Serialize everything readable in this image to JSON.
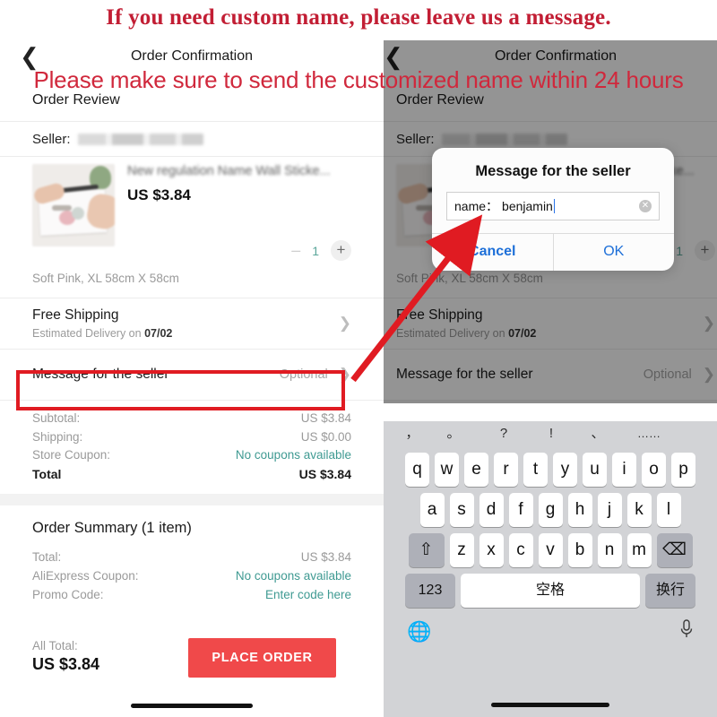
{
  "promo": {
    "line1": "If you need custom name, please leave us a message.",
    "line2": "Please make sure to send the customized name within 24 hours"
  },
  "navbar": {
    "title": "Order Confirmation",
    "back_icon": "chevron-left-icon"
  },
  "order_review": {
    "section_title": "Order Review",
    "seller_label": "Seller:",
    "product": {
      "title": "New regulation Name Wall Sticke...",
      "price": "US $3.84",
      "quantity": "1",
      "minus": "–",
      "plus": "+",
      "variant": "Soft Pink, XL 58cm X 58cm"
    },
    "shipping": {
      "title": "Free Shipping",
      "delivery_prefix": "Estimated Delivery on ",
      "delivery_date": "07/02"
    },
    "message_row": {
      "label": "Message for the seller",
      "value": "Optional"
    },
    "costs": [
      {
        "key": "Subtotal:",
        "value": "US $3.84",
        "teal": false
      },
      {
        "key": "Shipping:",
        "value": "US $0.00",
        "teal": false
      },
      {
        "key": "Store Coupon:",
        "value": "No coupons available",
        "teal": true
      }
    ],
    "total": {
      "key": "Total",
      "value": "US $3.84"
    }
  },
  "order_summary": {
    "heading": "Order Summary (1 item)",
    "rows": [
      {
        "key": "Total:",
        "value": "US $3.84",
        "teal": false
      },
      {
        "key": "AliExpress Coupon:",
        "value": "No coupons available",
        "teal": true
      },
      {
        "key": "Promo Code:",
        "value": "Enter code here",
        "teal": true
      }
    ],
    "all_total_label": "All Total:",
    "all_total_value": "US $3.84",
    "place_order_label": "PLACE ORDER"
  },
  "modal": {
    "title": "Message for the seller",
    "input_label": "name：",
    "input_value": "benjamin",
    "clear_icon": "✕",
    "cancel_label": "Cancel",
    "ok_label": "OK"
  },
  "keyboard": {
    "suggestions": [
      "，",
      "。",
      "?",
      "!",
      "、",
      "……"
    ],
    "row1": [
      "q",
      "w",
      "e",
      "r",
      "t",
      "y",
      "u",
      "i",
      "o",
      "p"
    ],
    "row2": [
      "a",
      "s",
      "d",
      "f",
      "g",
      "h",
      "j",
      "k",
      "l"
    ],
    "row3": [
      "z",
      "x",
      "c",
      "v",
      "b",
      "n",
      "m"
    ],
    "shift_icon": "⇧",
    "backspace_icon": "⌫",
    "numbers_label": "123",
    "space_label": "空格",
    "return_label": "换行",
    "globe_icon": "⊕",
    "mic_icon": "mic-icon"
  },
  "colors": {
    "promo_red": "#C21E34",
    "annotation_red": "#E01B22",
    "place_order": "#F0494A",
    "teal": "#3F9A92",
    "link_blue": "#1D6FD8"
  }
}
